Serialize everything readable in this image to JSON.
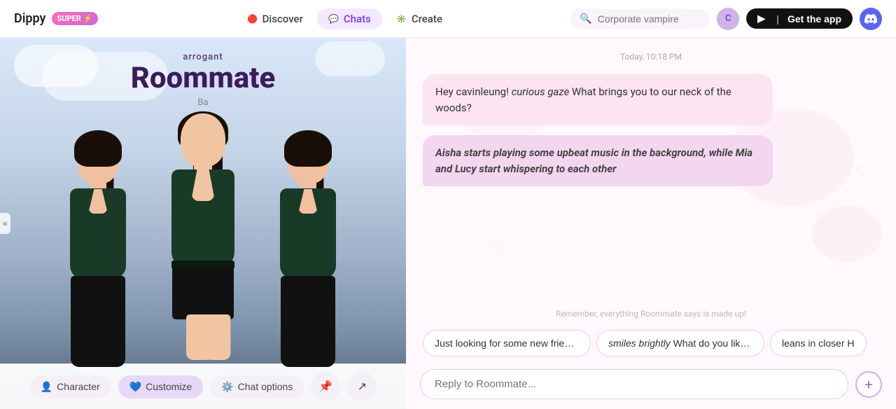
{
  "header": {
    "logo": "Dippy",
    "super_label": "SUPER ⚡",
    "nav": [
      {
        "id": "discover",
        "label": "Discover",
        "icon": "🔴"
      },
      {
        "id": "chats",
        "label": "Chats",
        "icon": "💬",
        "active": true
      },
      {
        "id": "create",
        "label": "Create",
        "icon": "✳️"
      }
    ],
    "search_placeholder": "Corporate vampire",
    "user_initial": "C",
    "get_app_label": "Get the app"
  },
  "character_panel": {
    "subtitle": "arrogant",
    "title": "Roommate",
    "by_label": "Ba",
    "collapse_icon": "«"
  },
  "toolbar": {
    "character_label": "Character",
    "customize_label": "Customize",
    "chat_options_label": "Chat options",
    "pin_icon": "📌",
    "share_icon": "↗"
  },
  "chat": {
    "timestamp": "Today, 10:18 PM",
    "messages": [
      {
        "id": "msg1",
        "type": "character",
        "text": "Hey cavinleung! curious gaze What brings you to our neck of the woods?",
        "italic_part": "curious gaze"
      },
      {
        "id": "msg2",
        "type": "action",
        "text": "Aisha starts playing some upbeat music in the background, while Mia and Lucy start whispering to each other"
      }
    ],
    "disclaimer": "Remember, everything Roommate says is made up!",
    "quick_replies": [
      "Just looking for some new friends.",
      "smiles brightly What do you like to do for fun?",
      "leans in closer H"
    ],
    "input_placeholder": "Reply to Roommate...",
    "add_button_icon": "+"
  }
}
